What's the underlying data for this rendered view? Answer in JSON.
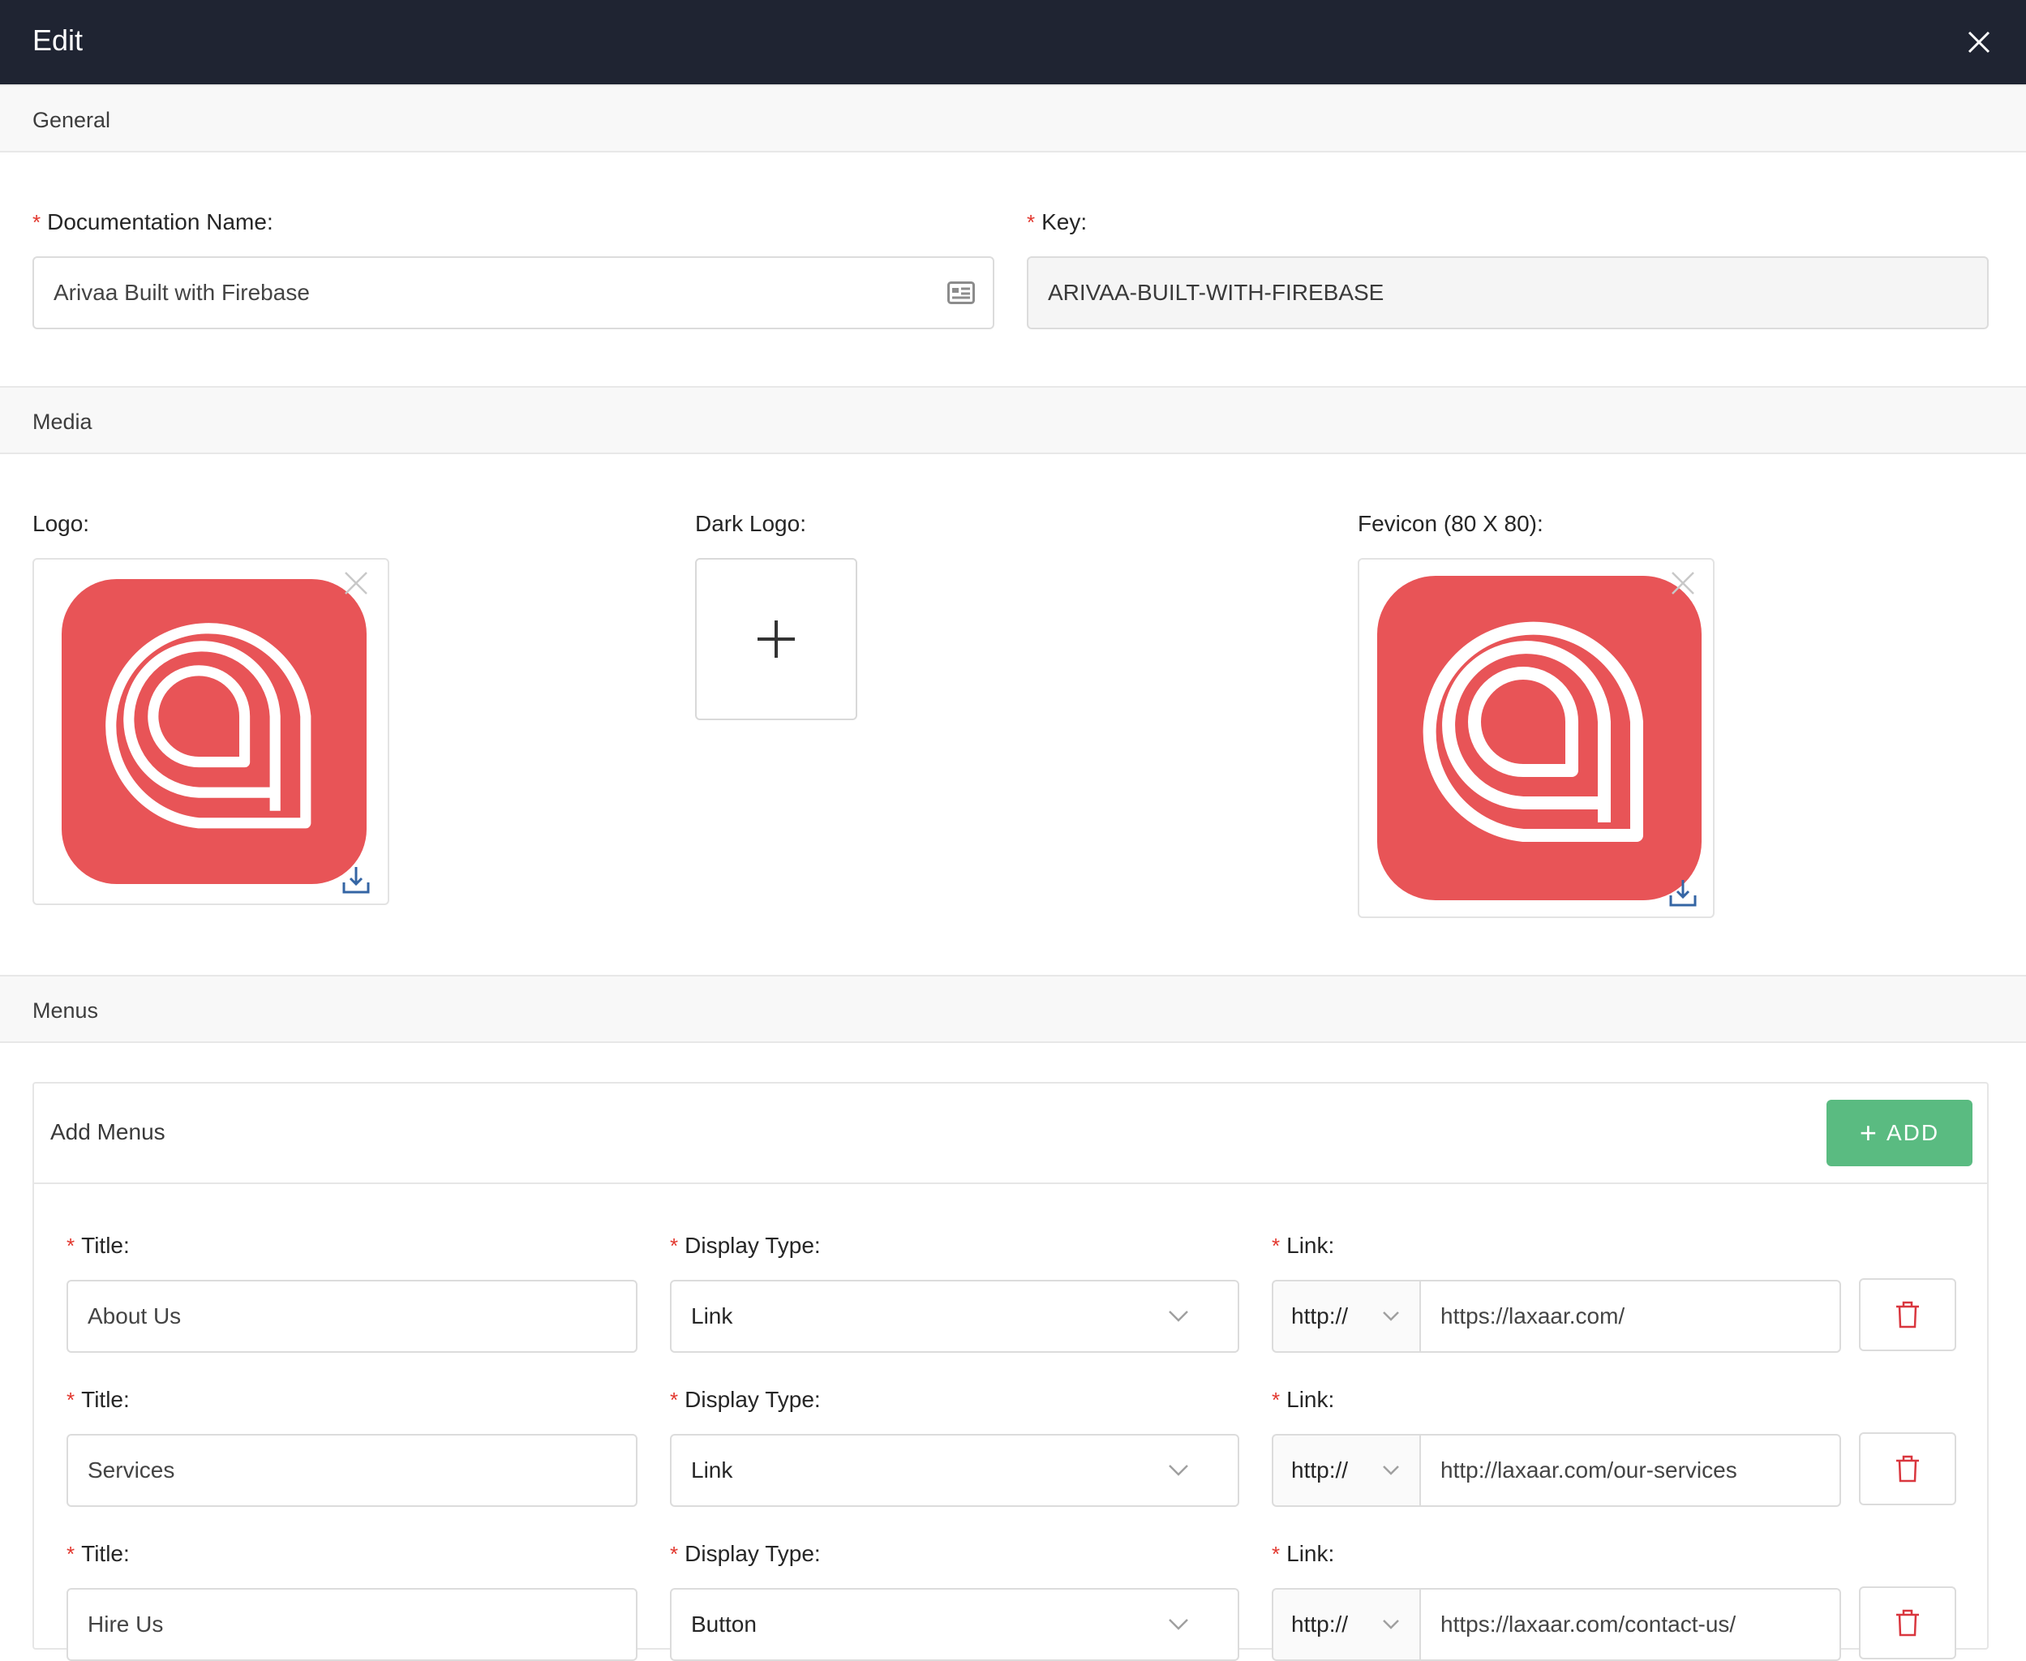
{
  "modal": {
    "title": "Edit"
  },
  "sections": {
    "general": "General",
    "media": "Media",
    "menus": "Menus"
  },
  "general": {
    "doc_name_label": "Documentation Name",
    "doc_name_value": "Arivaa Built with Firebase",
    "key_label": "Key",
    "key_value": "ARIVAA-BUILT-WITH-FIREBASE"
  },
  "media": {
    "logo_label": "Logo",
    "dark_logo_label": "Dark Logo",
    "favicon_label": "Fevicon (80 X 80)"
  },
  "menus": {
    "card_title": "Add Menus",
    "add_label": "ADD",
    "title_label": "Title",
    "display_type_label": "Display Type",
    "link_label": "Link",
    "rows": [
      {
        "title": "About Us",
        "display_type": "Link",
        "protocol": "http://",
        "url": "https://laxaar.com/"
      },
      {
        "title": "Services",
        "display_type": "Link",
        "protocol": "http://",
        "url": "http://laxaar.com/our-services"
      },
      {
        "title": "Hire Us",
        "display_type": "Button",
        "protocol": "http://",
        "url": "https://laxaar.com/contact-us/"
      }
    ]
  },
  "colors": {
    "header_bg": "#1f2432",
    "brand_red": "#e85457",
    "add_button_green": "#5abb81",
    "required_star": "#e2372e",
    "delete_icon": "#d9363e",
    "download_icon": "#3465a4"
  },
  "icons": {
    "close": "close-icon",
    "contact_card": "id-card-icon",
    "remove": "close-icon",
    "download": "download-icon",
    "plus": "plus-icon",
    "chevron": "chevron-down-icon",
    "delete": "trash-icon"
  }
}
